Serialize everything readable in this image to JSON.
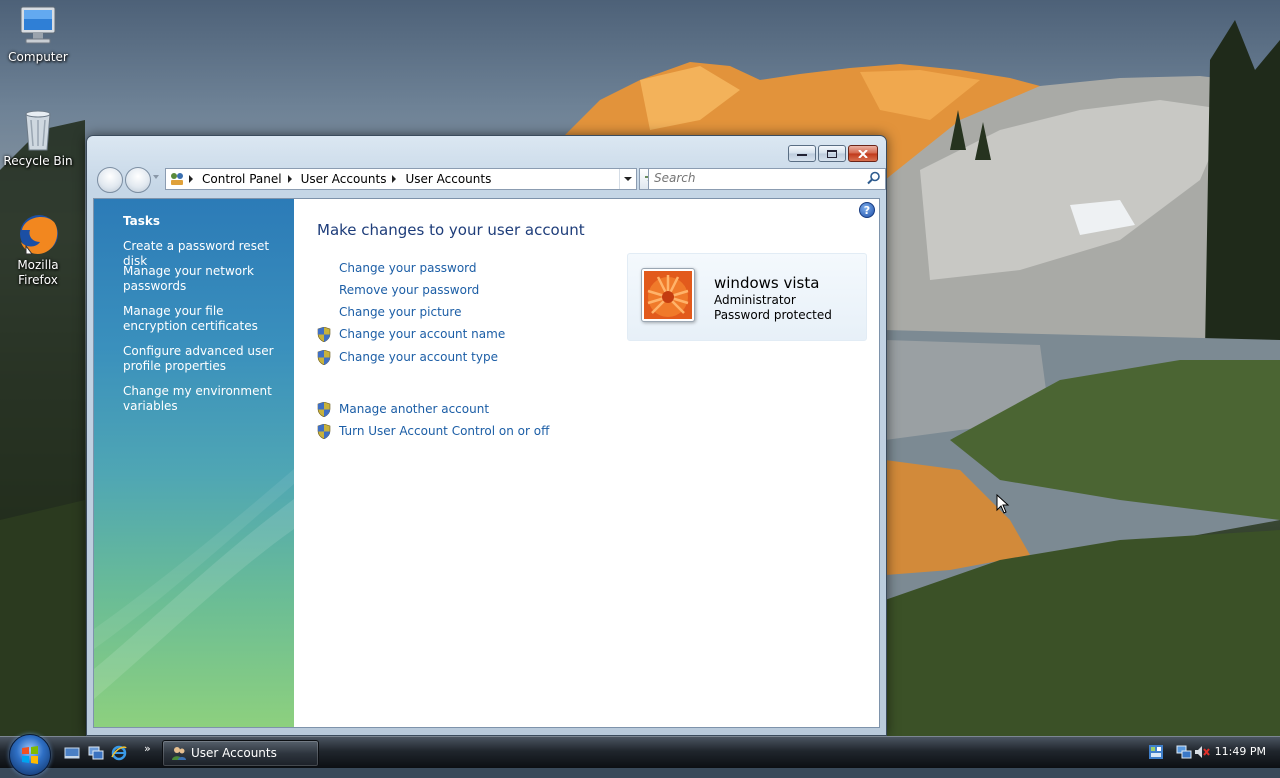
{
  "desktop": {
    "icons": [
      {
        "label": "Computer"
      },
      {
        "label": "Recycle Bin"
      },
      {
        "label": "Mozilla Firefox"
      }
    ]
  },
  "window": {
    "breadcrumb": [
      "Control Panel",
      "User Accounts",
      "User Accounts"
    ],
    "search_placeholder": "Search",
    "tasks": {
      "heading": "Tasks",
      "items": [
        "Create a password reset disk",
        "Manage your network passwords",
        "Manage your file encryption certificates",
        "Configure advanced user profile properties",
        "Change my environment variables"
      ]
    },
    "main": {
      "title": "Make changes to your user account",
      "links": [
        {
          "label": "Change your password",
          "shield": false
        },
        {
          "label": "Remove your password",
          "shield": false
        },
        {
          "label": "Change your picture",
          "shield": false
        },
        {
          "label": "Change your account name",
          "shield": true
        },
        {
          "label": "Change your account type",
          "shield": true
        },
        {
          "label": "Manage another account",
          "shield": true
        },
        {
          "label": "Turn User Account Control on or off",
          "shield": true
        }
      ]
    },
    "account": {
      "name": "windows vista",
      "type": "Administrator",
      "status": "Password protected"
    }
  },
  "taskbar": {
    "active_window": "User Accounts",
    "clock": "11:49 PM"
  },
  "colors": {
    "link": "#1c5ea6",
    "title": "#1e3d7a",
    "task_pane_top": "#2c7bb7",
    "task_pane_bottom": "#8dd07e"
  }
}
